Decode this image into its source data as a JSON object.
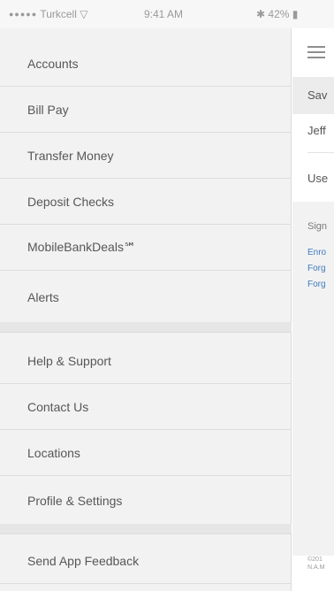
{
  "status_bar": {
    "carrier": "Turkcell",
    "time": "9:41 AM",
    "battery": "42%"
  },
  "drawer": {
    "items": [
      {
        "label": "Accounts"
      },
      {
        "label": "Bill Pay"
      },
      {
        "label": "Transfer Money"
      },
      {
        "label": "Deposit Checks"
      },
      {
        "label": "MobileBankDeals℠"
      },
      {
        "label": "Alerts"
      },
      {
        "label": "Help & Support"
      },
      {
        "label": "Contact Us"
      },
      {
        "label": "Locations"
      },
      {
        "label": "Profile & Settings"
      },
      {
        "label": "Send App Feedback"
      }
    ]
  },
  "main_peek": {
    "save_label": "Sav",
    "username_value": "Jeff",
    "use_label": "Use",
    "sign_label": "Sign",
    "links": [
      "Enro",
      "Forg",
      "Forg"
    ],
    "footer_lines": [
      "©201",
      "N.A.M"
    ]
  }
}
